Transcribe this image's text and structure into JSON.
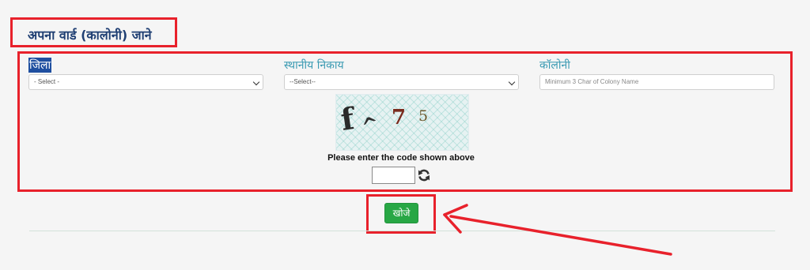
{
  "section": {
    "title": "अपना वार्ड (कालोनी) जाने"
  },
  "form": {
    "district": {
      "label": "जिला",
      "selected": "- Select -"
    },
    "local_body": {
      "label": "स्थानीय निकाय",
      "selected": "--Select--"
    },
    "colony": {
      "label": "कॉलोनी",
      "placeholder": "Minimum 3 Char of Colony Name"
    }
  },
  "captcha": {
    "characters": [
      "f",
      "^",
      "7",
      "5"
    ],
    "prompt": "Please enter the code shown above",
    "input_value": "",
    "refresh_icon": "refresh-icon"
  },
  "search_button": {
    "label": "खोजे"
  },
  "colors": {
    "highlight": "#e8212b",
    "title": "#1f3f73",
    "label": "#3a9ab2",
    "button": "#28a745"
  }
}
